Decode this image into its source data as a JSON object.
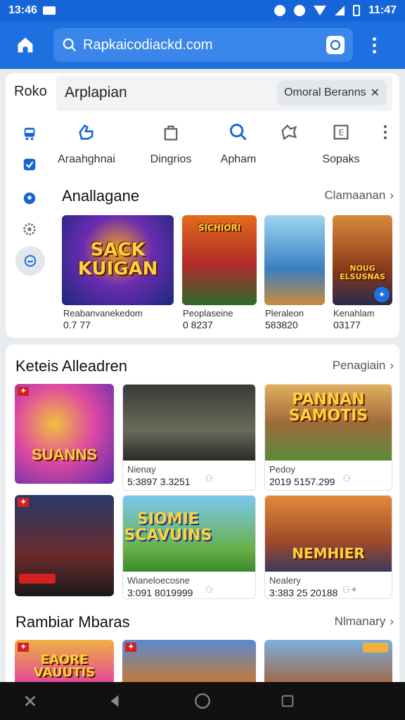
{
  "status": {
    "time": "13:46",
    "right": "11:47"
  },
  "browser": {
    "url": "Rapkaicodiackd.com"
  },
  "card1": {
    "tab_short": "Roko",
    "tab_title": "Arplapian",
    "chip": "Omoral Beranns",
    "categories": [
      {
        "label": "Araahghnai",
        "icon": "thumb-icon"
      },
      {
        "label": "Dingrios",
        "icon": "shopping-bag-icon"
      },
      {
        "label": "Apham",
        "icon": "search-icon"
      },
      {
        "label": "",
        "icon": "puzzle-icon"
      },
      {
        "label": "Sopaks",
        "icon": "box-e-icon"
      }
    ],
    "section_title": "Anallagane",
    "section_link": "Clamaanan",
    "tiles": [
      {
        "art": "SACK KUIGAN",
        "cap": "Reabanvanekedom",
        "meta": "0.7 77"
      },
      {
        "art": "SICHIORI",
        "cap": "Peoplaseine",
        "meta": "0 8237"
      },
      {
        "art": "",
        "cap": "Pleraleon",
        "meta": "583820"
      },
      {
        "art": "NOUG ELSUSNAS",
        "cap": "Kenahlam",
        "meta": "03177"
      }
    ]
  },
  "card2": {
    "section1_title": "Keteis Alleadren",
    "section1_link": "Penagiain",
    "row1": [
      {
        "art": "SUANNS"
      },
      {
        "line1": "Nienay",
        "line2": "5:3897 3.3251"
      },
      {
        "line1": "Pedoy",
        "line2": "2019 5157.299",
        "art": "PANNAN SAMOTIS"
      }
    ],
    "row2": [
      {
        "art": ""
      },
      {
        "line1": "Wianeloecosne",
        "line2": "3:091 8019999",
        "art": "SIOMIE SCAVUINS"
      },
      {
        "line1": "Nealery",
        "line2": "3:383 25 20188",
        "art": "NEMHIER"
      }
    ],
    "section2_title": "Rambiar Mbaras",
    "section2_link": "Nlmanary",
    "row3": [
      {
        "art": "EAORE VAUUTIS"
      },
      {
        "art": ""
      },
      {
        "art": ""
      }
    ]
  },
  "colors": {
    "brand": "#1e6fe0",
    "statusbar": "#1565d8",
    "accent": "#1565d8"
  }
}
